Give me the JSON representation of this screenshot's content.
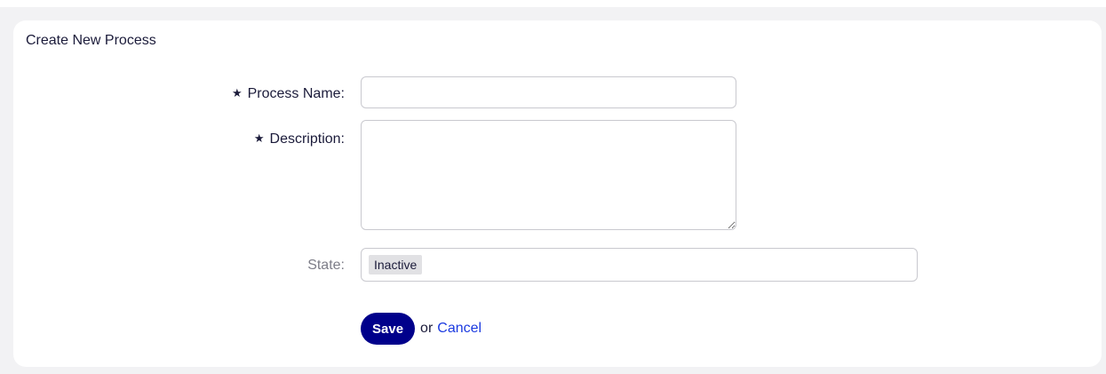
{
  "form": {
    "title": "Create New Process",
    "required_marker": "★",
    "process_name": {
      "label": "Process Name:",
      "value": ""
    },
    "description": {
      "label": "Description:",
      "value": ""
    },
    "state": {
      "label": "State:",
      "value": "Inactive"
    },
    "actions": {
      "save_label": "Save",
      "or_label": "or",
      "cancel_label": "Cancel"
    }
  },
  "colors": {
    "accent": "#00008b",
    "link": "#1b3ae0",
    "text": "#1b1b3a",
    "muted_text": "#7d7d88",
    "page_background": "#f2f2f4",
    "panel_background": "#ffffff"
  }
}
